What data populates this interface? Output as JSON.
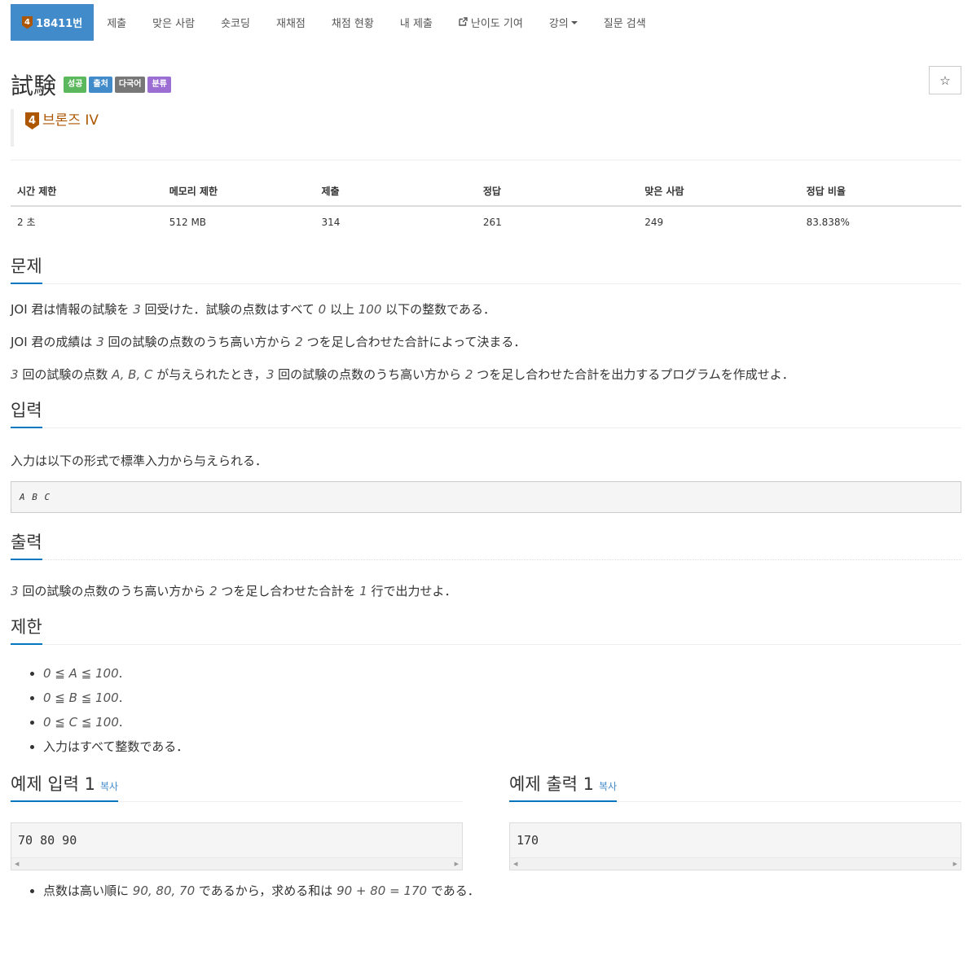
{
  "nav": {
    "problem_tab": {
      "tier": "4",
      "label": "18411번"
    },
    "items": [
      "제출",
      "맞은 사람",
      "숏코딩",
      "재채점",
      "채점 현황",
      "내 제출",
      "난이도 기여",
      "강의",
      "질문 검색"
    ]
  },
  "title": "試験",
  "labels": [
    "성공",
    "출처",
    "다국어",
    "분류"
  ],
  "star": "☆",
  "tier": {
    "number": "4",
    "name": "브론즈 IV"
  },
  "stats": {
    "headers": [
      "시간 제한",
      "메모리 제한",
      "제출",
      "정답",
      "맞은 사람",
      "정답 비율"
    ],
    "values": [
      "2 초",
      "512 MB",
      "314",
      "261",
      "249",
      "83.838%"
    ]
  },
  "sections": {
    "problem": "문제",
    "input": "입력",
    "output": "출력",
    "limits": "제한"
  },
  "problem": {
    "p1": {
      "a": "JOI 君は情報の試験を ",
      "m1": "3",
      "b": " 回受けた．試験の点数はすべて ",
      "m2": "0",
      "c": " 以上 ",
      "m3": "100",
      "d": " 以下の整数である．"
    },
    "p2": {
      "a": "JOI 君の成績は ",
      "m1": "3",
      "b": " 回の試験の点数のうち高い方から ",
      "m2": "2",
      "c": " つを足し合わせた合計によって決まる．"
    },
    "p3": {
      "m1": "3",
      "a": " 回の試験の点数 ",
      "m2": "A, B, C",
      "b": " が与えられたとき，",
      "m3": "3",
      "c": " 回の試験の点数のうち高い方から ",
      "m4": "2",
      "d": " つを足し合わせた合計を出力するプログラムを作成せよ．"
    }
  },
  "input": {
    "text": "入力は以下の形式で標準入力から与えられる．",
    "format": "A B C"
  },
  "output": {
    "m1": "3",
    "a": " 回の試験の点数のうち高い方から ",
    "m2": "2",
    "b": " つを足し合わせた合計を ",
    "m3": "1",
    "c": " 行で出力せよ．"
  },
  "limits": [
    {
      "math": "0 ≦ A ≦ 100",
      "tail": "."
    },
    {
      "math": "0 ≦ B ≦ 100",
      "tail": "."
    },
    {
      "math": "0 ≦ C ≦ 100",
      "tail": "."
    },
    {
      "math": "",
      "tail": "入力はすべて整数である．"
    }
  ],
  "examples": {
    "input_title": "예제 입력 1",
    "output_title": "예제 출력 1",
    "copy": "복사",
    "input_value": "70 80 90",
    "output_value": "170"
  },
  "note": {
    "a": "点数は高い順に ",
    "m1": "90, 80, 70",
    "b": " であるから，求める和は ",
    "m2": "90 + 80 = 170",
    "c": " である．"
  }
}
